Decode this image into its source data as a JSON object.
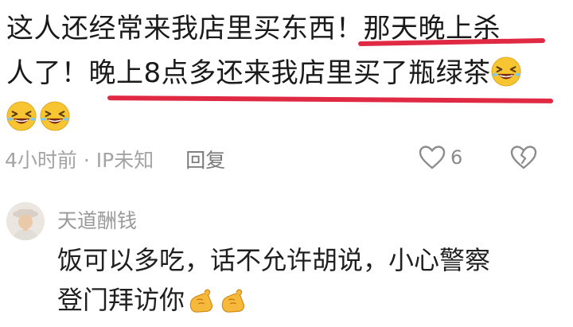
{
  "comment": {
    "line1": "这人还经常来我店里买东西！那天晚上杀",
    "line2": "人了！晚上8点多还来我店里买了瓶绿茶",
    "emojis": [
      "laughing-face",
      "laughing-face",
      "laughing-face"
    ],
    "time": "4小时前 · IP未知",
    "reply_label": "回复",
    "like_count": "6",
    "underline_color": "#e02a44"
  },
  "reply": {
    "username": "天道酬钱",
    "text_line1": "饭可以多吃，话不允许胡说，小心警察",
    "text_line2": "登门拜访你",
    "emojis": [
      "fist-bump",
      "fist-bump"
    ]
  }
}
